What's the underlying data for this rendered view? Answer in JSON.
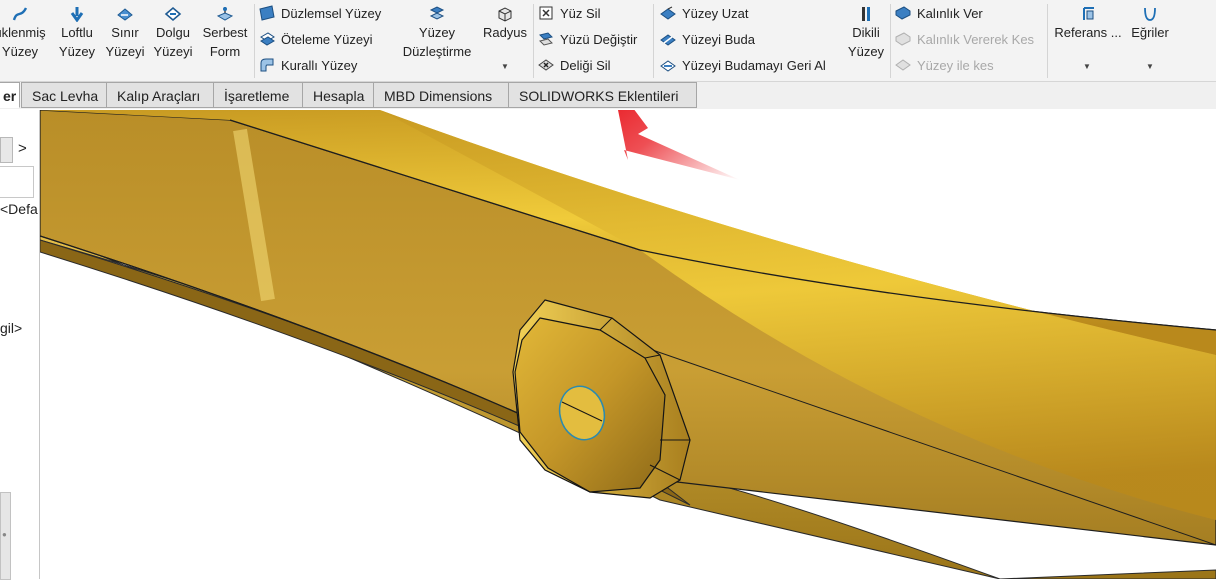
{
  "ribbon": {
    "large_buttons": [
      {
        "line1": "üklenmiş",
        "line2": "Yüzey"
      },
      {
        "line1": "Loftlu",
        "line2": "Yüzey"
      },
      {
        "line1": "Sınır",
        "line2": "Yüzeyi"
      },
      {
        "line1": "Dolgu",
        "line2": "Yüzeyi"
      },
      {
        "line1": "Serbest",
        "line2": "Form"
      },
      {
        "line1": "Yüzey",
        "line2": "Düzleştirme"
      },
      {
        "line1": "Radyus",
        "line2": ""
      },
      {
        "line1": "Dikili",
        "line2": "Yüzey"
      },
      {
        "line1": "Referans ...",
        "line2": ""
      },
      {
        "line1": "Eğriler",
        "line2": ""
      }
    ],
    "surface_group": [
      "Düzlemsel Yüzey",
      "Öteleme Yüzeyi",
      "Kurallı Yüzey"
    ],
    "face_group": [
      "Yüz Sil",
      "Yüzü Değiştir",
      "Deliği Sil"
    ],
    "extend_group": [
      "Yüzey Uzat",
      "Yüzeyi Buda",
      "Yüzeyi Budamayı Geri Al"
    ],
    "thicken_group": [
      {
        "label": "Kalınlık Ver",
        "enabled": true
      },
      {
        "label": "Kalınlık Vererek Kes",
        "enabled": false
      },
      {
        "label": "Yüzey ile kes",
        "enabled": false
      }
    ]
  },
  "tabs": [
    {
      "label": "er",
      "active": true
    },
    {
      "label": "Sac Levha",
      "active": false
    },
    {
      "label": "Kalıp Araçları",
      "active": false
    },
    {
      "label": "İşaretleme",
      "active": false
    },
    {
      "label": "Hesapla",
      "active": false
    },
    {
      "label": "MBD Dimensions",
      "active": false
    },
    {
      "label": "SOLIDWORKS Eklentileri",
      "active": false
    }
  ],
  "left_panel": {
    "nav_arrow": ">",
    "config_text": "<Defa",
    "item_text": "gil>"
  },
  "colors": {
    "accent": "#1e6fb5",
    "part_gold": "#c9a032",
    "annotation_arrow": "#e8141b"
  },
  "view_toolbar_icons": [
    "zoom-to-fit-icon",
    "zoom-area-icon",
    "previous-view-icon",
    "section-view-icon",
    "view-orientation-icon",
    "display-style-icon",
    "hide-show-icon",
    "edit-appearance-icon",
    "apply-scene-icon",
    "view-settings-icon"
  ]
}
